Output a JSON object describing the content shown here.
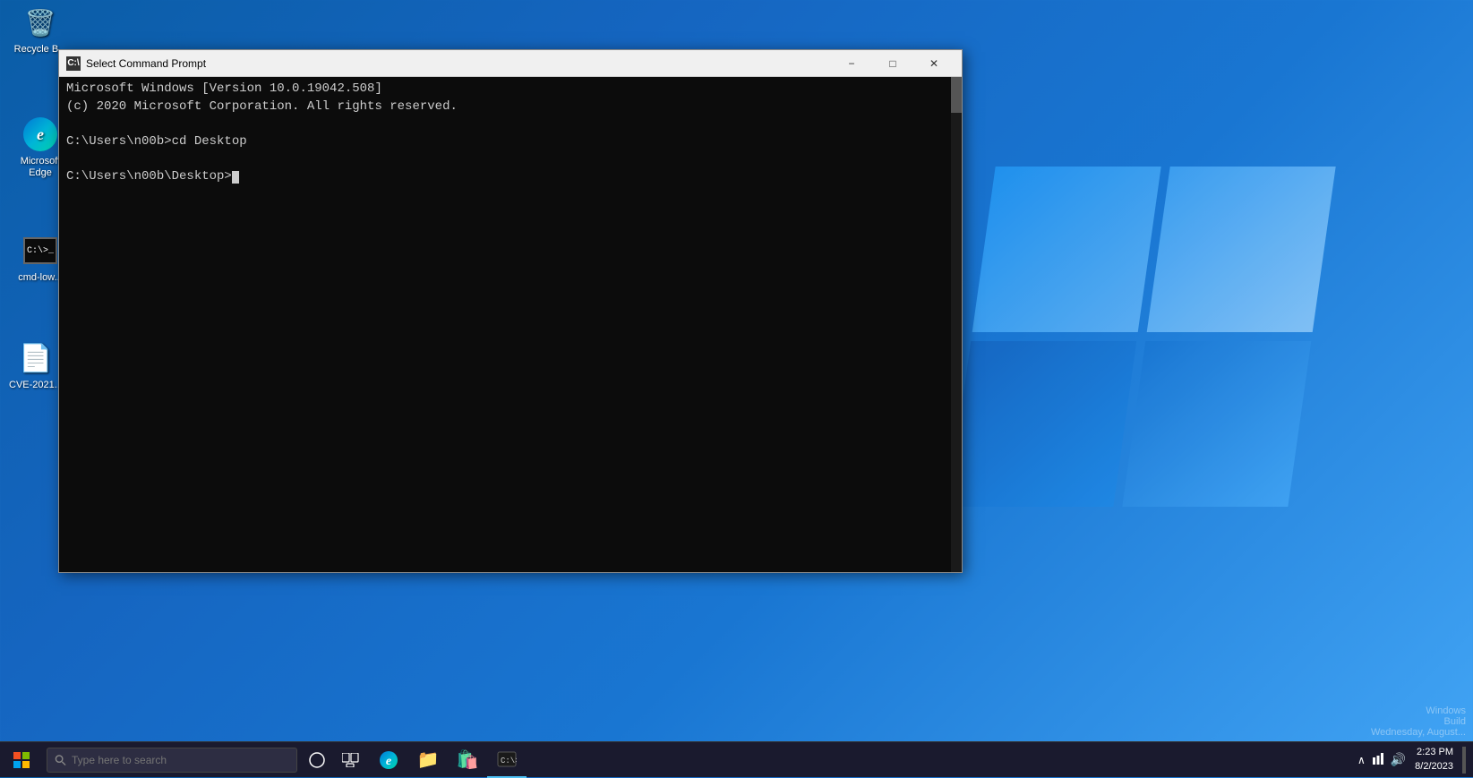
{
  "desktop": {
    "icons": [
      {
        "id": "recycle-bin",
        "label": "Recycle B...",
        "icon": "🗑️"
      },
      {
        "id": "microsoft-edge",
        "label": "Microsoft Edge",
        "icon": "edge"
      },
      {
        "id": "cmd-low",
        "label": "cmd-low...",
        "icon": "cmd"
      },
      {
        "id": "cve-2021",
        "label": "CVE-2021...",
        "icon": "📄"
      }
    ]
  },
  "cmd_window": {
    "title": "Select Command Prompt",
    "titlebar_icon": "C:\\",
    "lines": [
      "Microsoft Windows [Version 10.0.19042.508]",
      "(c) 2020 Microsoft Corporation. All rights reserved.",
      "",
      "C:\\Users\\n00b>cd Desktop",
      "",
      "C:\\Users\\n00b\\Desktop>"
    ],
    "minimize_label": "−",
    "maximize_label": "□",
    "close_label": "✕"
  },
  "taskbar": {
    "start_icon": "⊞",
    "search_placeholder": "Type here to search",
    "cortana_icon": "○",
    "task_view_icon": "⧉",
    "apps": [
      {
        "id": "edge",
        "icon": "edge_app",
        "active": false
      },
      {
        "id": "file-explorer",
        "icon": "📁",
        "active": false
      },
      {
        "id": "store",
        "icon": "🛍️",
        "active": false
      },
      {
        "id": "terminal",
        "icon": "⬛",
        "active": true
      }
    ],
    "clock_time": "2:23 PM",
    "clock_date": "8/2/2023",
    "build_watermark_line1": "Windows",
    "build_watermark_line2": "Build",
    "build_watermark_line3": "Wednesday, August..."
  }
}
